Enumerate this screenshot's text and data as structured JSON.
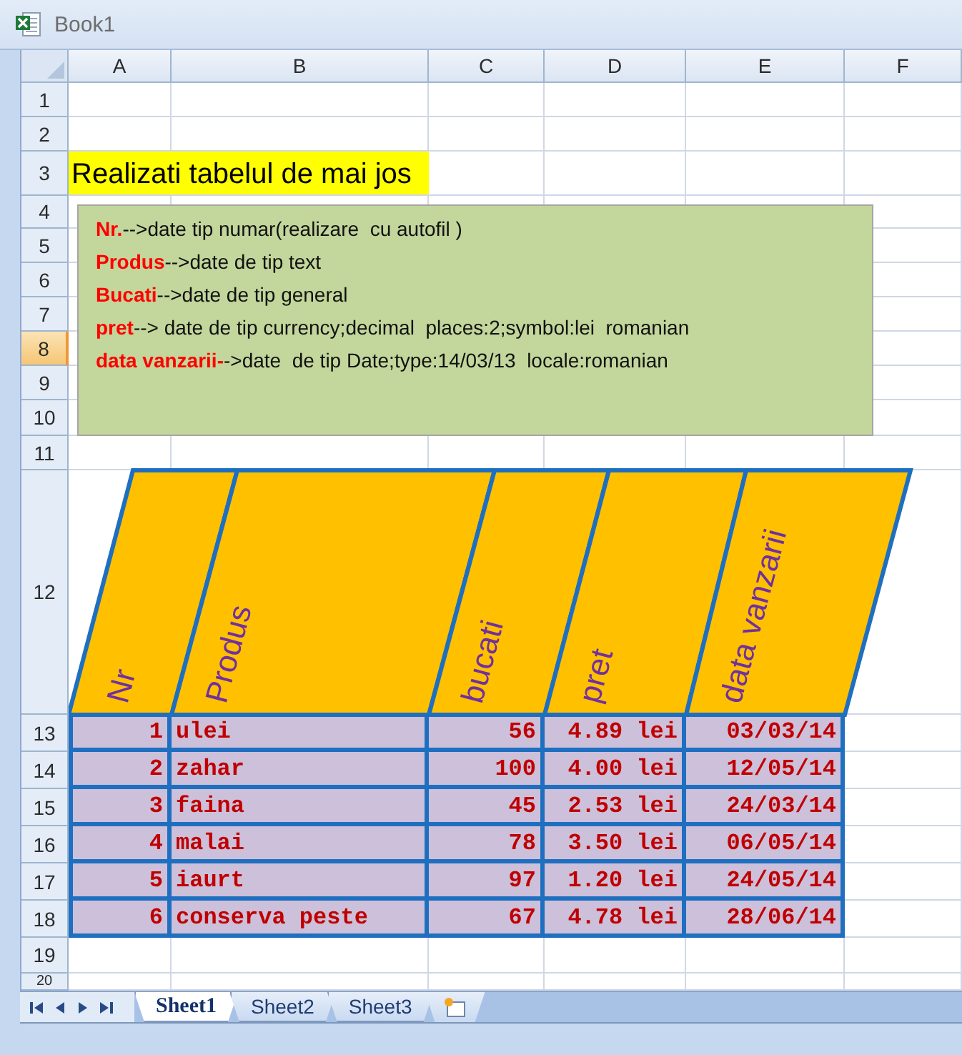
{
  "window": {
    "title": "Book1"
  },
  "columns": [
    {
      "label": "A",
      "selected": false
    },
    {
      "label": "B",
      "selected": false
    },
    {
      "label": "C",
      "selected": false
    },
    {
      "label": "D",
      "selected": false
    },
    {
      "label": "E",
      "selected": false
    },
    {
      "label": "F",
      "selected": false
    }
  ],
  "rows": [
    {
      "label": "1",
      "selected": false
    },
    {
      "label": "2",
      "selected": false
    },
    {
      "label": "3",
      "selected": false
    },
    {
      "label": "4",
      "selected": false
    },
    {
      "label": "5",
      "selected": false
    },
    {
      "label": "6",
      "selected": false
    },
    {
      "label": "7",
      "selected": false
    },
    {
      "label": "8",
      "selected": true
    },
    {
      "label": "9",
      "selected": false
    },
    {
      "label": "10",
      "selected": false
    },
    {
      "label": "11",
      "selected": false
    },
    {
      "label": "12",
      "selected": false
    },
    {
      "label": "13",
      "selected": false
    },
    {
      "label": "14",
      "selected": false
    },
    {
      "label": "15",
      "selected": false
    },
    {
      "label": "16",
      "selected": false
    },
    {
      "label": "17",
      "selected": false
    },
    {
      "label": "18",
      "selected": false
    },
    {
      "label": "19",
      "selected": false
    },
    {
      "label": "20",
      "selected": false
    }
  ],
  "heading": "Realizati tabelul de mai jos",
  "note": [
    "**Nr.**-->date tip numar(realizare  cu autofil )",
    "**Produs**-->date de tip text",
    "**Bucati**-->date de tip general",
    "**pret**--> date de tip currency;decimal  places:2;symbol:lei  romanian",
    "**data vanzarii-**->date  de tip Date;type:14/03/13  locale:romanian"
  ],
  "table": {
    "headers": [
      "Nr",
      "Produs",
      "bucati",
      "pret",
      "data vanzarii"
    ],
    "rows": [
      [
        "1",
        "ulei",
        "56",
        "4.89 lei",
        "03/03/14"
      ],
      [
        "2",
        "zahar",
        "100",
        "4.00 lei",
        "12/05/14"
      ],
      [
        "3",
        "faina",
        "45",
        "2.53 lei",
        "24/03/14"
      ],
      [
        "4",
        "malai",
        "78",
        "3.50 lei",
        "06/05/14"
      ],
      [
        "5",
        "iaurt",
        "97",
        "1.20 lei",
        "24/05/14"
      ],
      [
        "6",
        "conserva peste",
        "67",
        "4.78 lei",
        "28/06/14"
      ]
    ]
  },
  "sheet_tabs": [
    {
      "label": "Sheet1",
      "selected": true
    },
    {
      "label": "Sheet2",
      "selected": false
    },
    {
      "label": "Sheet3",
      "selected": false
    }
  ]
}
